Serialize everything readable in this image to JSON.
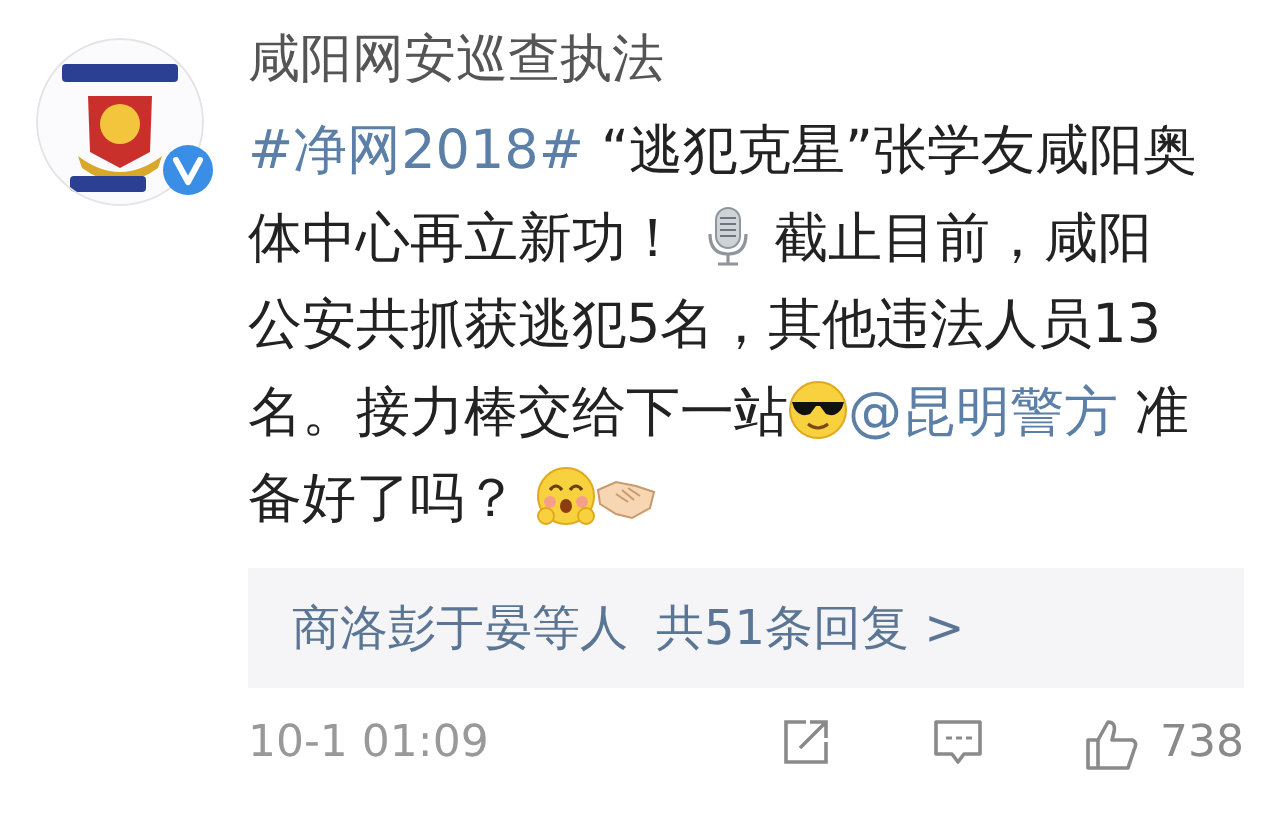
{
  "post": {
    "author": "咸阳网安巡查执法",
    "verified": true,
    "body": [
      {
        "kind": "hashtag",
        "text": "#净网2018#"
      },
      {
        "kind": "text",
        "text": " “逃犯克星”张学友咸阳奥体中心再立新功！ "
      },
      {
        "kind": "mic"
      },
      {
        "kind": "text",
        "text": " 截止目前，咸阳公安共抓获逃犯5名，其他违法人员13名。接力棒交给下一站"
      },
      {
        "kind": "cool"
      },
      {
        "kind": "mention",
        "text": "@昆明警方"
      },
      {
        "kind": "text",
        "text": " 准备好了吗？ "
      },
      {
        "kind": "smile"
      },
      {
        "kind": "handshake"
      }
    ],
    "replies": {
      "names": "商洛彭于晏等人",
      "count": "共51条回复 >"
    },
    "time": "10-1 01:09",
    "actions": [
      {
        "kind": "share"
      },
      {
        "kind": "comment"
      },
      {
        "kind": "like",
        "count": "738"
      }
    ]
  }
}
